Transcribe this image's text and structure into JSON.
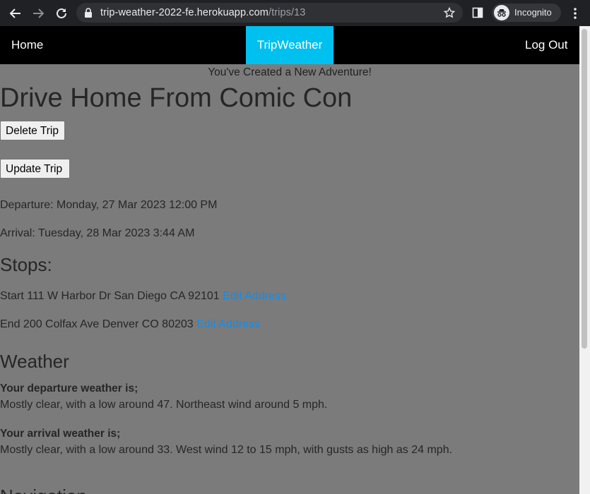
{
  "browser": {
    "url_host": "trip-weather-2022-fe.herokuapp.com",
    "url_path": "/trips/13",
    "incognito_label": "Incognito"
  },
  "navbar": {
    "home": "Home",
    "brand": "TripWeather",
    "logout": "Log Out"
  },
  "notice": "You've Created a New Adventure!",
  "trip": {
    "title": "Drive Home From Comic Con",
    "delete_label": "Delete Trip",
    "update_label": "Update Trip",
    "departure": "Departure: Monday, 27 Mar 2023 12:00 PM",
    "arrival": "Arrival: Tuesday, 28 Mar 2023 3:44 AM"
  },
  "stops": {
    "heading": "Stops:",
    "items": [
      {
        "text": "Start 111 W Harbor Dr San Diego CA 92101",
        "link": "Edit Address"
      },
      {
        "text": "End 200 Colfax Ave Denver CO 80203",
        "link": "Edit Address"
      }
    ]
  },
  "weather": {
    "heading": "Weather",
    "departure_label": "Your departure weather is;",
    "departure_text": "Mostly clear, with a low around 47. Northeast wind around 5 mph.",
    "arrival_label": "Your arrival weather is;",
    "arrival_text": "Mostly clear, with a low around 33. West wind 12 to 15 mph, with gusts as high as 24 mph."
  },
  "next_heading": "Navigation"
}
